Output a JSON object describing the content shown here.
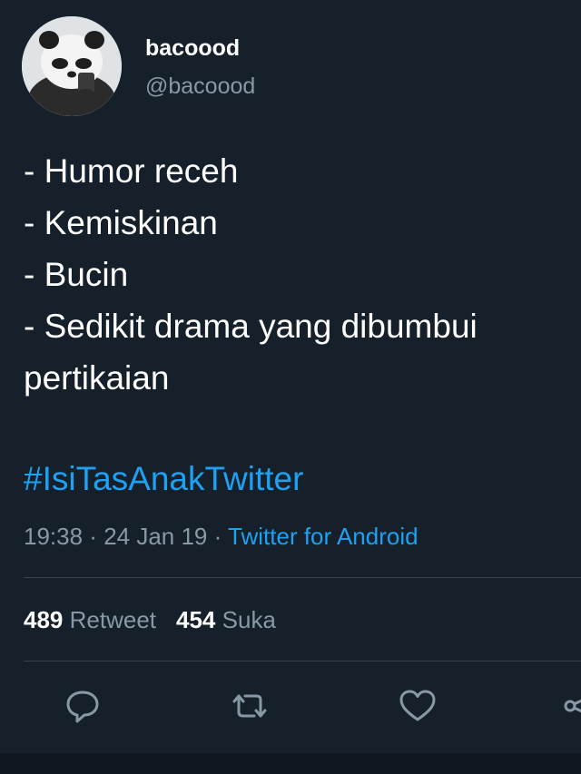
{
  "user": {
    "display_name": "bacoood",
    "handle": "@bacoood",
    "avatar_icon": "panda-avatar"
  },
  "tweet": {
    "lines": [
      "- Humor receh",
      "- Kemiskinan",
      "- Bucin",
      "- Sedikit drama yang dibumbui",
      "pertikaian"
    ],
    "hashtag": "#IsiTasAnakTwitter"
  },
  "meta": {
    "time": "19:38",
    "separator1": " · ",
    "date": "24 Jan 19",
    "separator2": " · ",
    "source": "Twitter for Android"
  },
  "stats": {
    "retweet_count": "489",
    "retweet_label": "Retweet",
    "like_count": "454",
    "like_label": "Suka"
  },
  "actions": [
    {
      "icon": "reply-icon"
    },
    {
      "icon": "retweet-icon"
    },
    {
      "icon": "like-icon"
    },
    {
      "icon": "share-icon"
    }
  ],
  "colors": {
    "background": "#15202b",
    "accent": "#1da1f2",
    "secondary_text": "#8899a6",
    "divider": "#38444d"
  }
}
